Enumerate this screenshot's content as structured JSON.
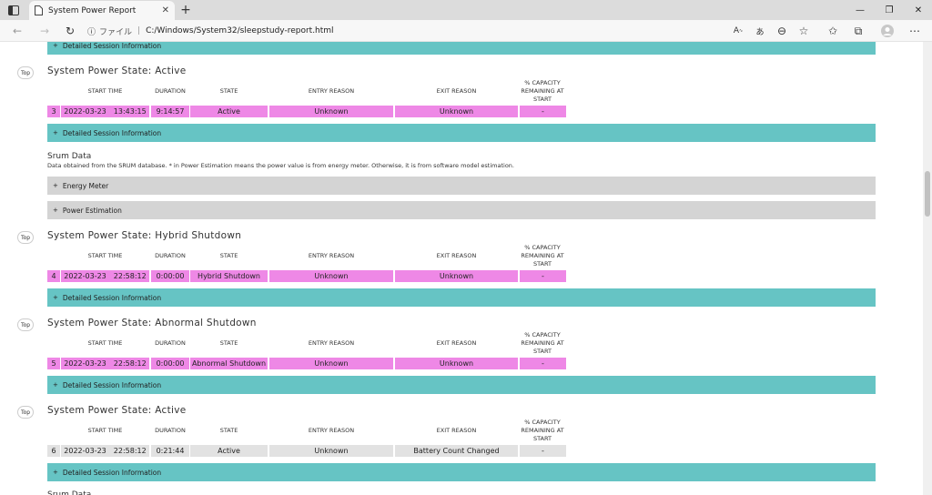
{
  "browser": {
    "tab_title": "System Power Report",
    "new_tab": "+",
    "address_label": "ファイル",
    "url": "C:/Windows/System32/sleepstudy-report.html"
  },
  "report": {
    "top_label": "Top",
    "details_label": "Detailed Session Information",
    "columns": [
      "START TIME",
      "DURATION",
      "STATE",
      "ENTRY REASON",
      "EXIT REASON",
      "% CAPACITY REMAINING AT START"
    ],
    "sections": [
      {
        "title": "System Power State: Active",
        "row": {
          "n": "3",
          "date": "2022-03-23",
          "time": "13:43:15",
          "duration": "9:14:57",
          "state": "Active",
          "entry": "Unknown",
          "exit": "Unknown",
          "capacity": "-"
        },
        "style": "pink"
      },
      {
        "title": "System Power State: Hybrid Shutdown",
        "row": {
          "n": "4",
          "date": "2022-03-23",
          "time": "22:58:12",
          "duration": "0:00:00",
          "state": "Hybrid Shutdown",
          "entry": "Unknown",
          "exit": "Unknown",
          "capacity": "-"
        },
        "style": "pink"
      },
      {
        "title": "System Power State: Abnormal Shutdown",
        "row": {
          "n": "5",
          "date": "2022-03-23",
          "time": "22:58:12",
          "duration": "0:00:00",
          "state": "Abnormal Shutdown",
          "entry": "Unknown",
          "exit": "Unknown",
          "capacity": "-"
        },
        "style": "pink"
      },
      {
        "title": "System Power State: Active",
        "row": {
          "n": "6",
          "date": "2022-03-23",
          "time": "22:58:12",
          "duration": "0:21:44",
          "state": "Active",
          "entry": "Unknown",
          "exit": "Battery Count Changed",
          "capacity": "-"
        },
        "style": "gray"
      }
    ],
    "srum": {
      "title": "Srum Data",
      "description": "Data obtained from the SRUM database. * in Power Estimation means the power value is from energy meter. Otherwise, it is from software model estimation.",
      "energy_meter": "Energy Meter",
      "power_estimation": "Power Estimation"
    },
    "srum_next_title": "Srum Data"
  }
}
